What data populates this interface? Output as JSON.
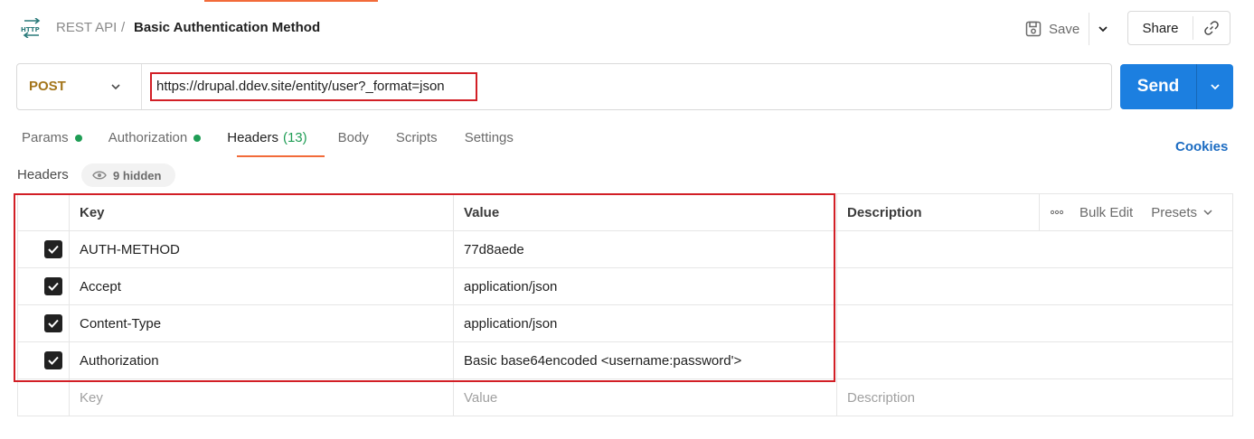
{
  "header": {
    "icon": "http-icon",
    "breadcrumb_parent": "REST API",
    "breadcrumb_separator": "/",
    "title": "Basic Authentication Method",
    "save_label": "Save",
    "share_label": "Share"
  },
  "request": {
    "method": "POST",
    "url": "https://drupal.ddev.site/entity/user?_format=json",
    "send_label": "Send"
  },
  "tabs": [
    {
      "label": "Params"
    },
    {
      "label": "Authorization"
    },
    {
      "label": "Headers",
      "count": "(13)"
    },
    {
      "label": "Body"
    },
    {
      "label": "Scripts"
    },
    {
      "label": "Settings"
    }
  ],
  "cookies_label": "Cookies",
  "headers_section": {
    "label": "Headers",
    "hidden_label": "9 hidden"
  },
  "table": {
    "columns": {
      "key": "Key",
      "value": "Value",
      "description": "Description"
    },
    "bulk_edit": "Bulk Edit",
    "presets": "Presets",
    "rows": [
      {
        "key": "AUTH-METHOD",
        "value": "77d8aede",
        "checked": true
      },
      {
        "key": "Accept",
        "value": "application/json",
        "checked": true
      },
      {
        "key": "Content-Type",
        "value": "application/json",
        "checked": true
      },
      {
        "key": "Authorization",
        "value": "Basic base64encoded <username:password'>",
        "checked": true
      }
    ],
    "placeholders": {
      "key": "Key",
      "value": "Value",
      "description": "Description"
    }
  },
  "colors": {
    "accent": "#f26b3a",
    "send": "#1c7fe0",
    "method_post": "#a3751a",
    "status_dot": "#1f9d55",
    "highlight_box": "#d21f26",
    "link": "#1c6cc2"
  }
}
